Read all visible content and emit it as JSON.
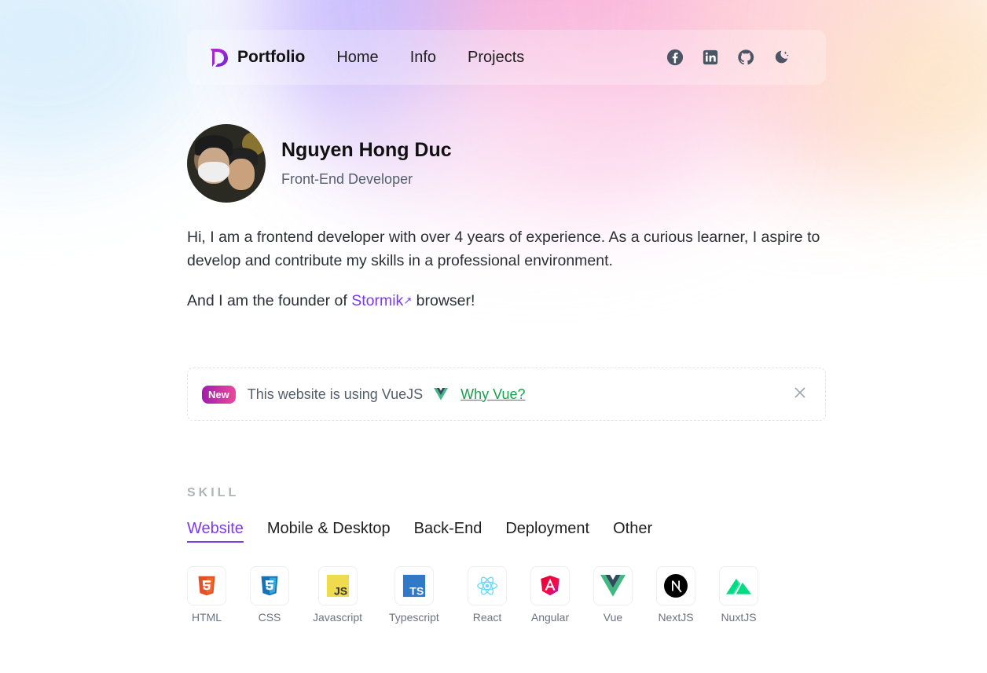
{
  "nav": {
    "brand": "Portfolio",
    "links": [
      "Home",
      "Info",
      "Projects"
    ],
    "icons": [
      "facebook-icon",
      "linkedin-icon",
      "github-icon",
      "theme-toggle-icon"
    ]
  },
  "profile": {
    "name": "Nguyen Hong Duc",
    "role": "Front-End Developer"
  },
  "bio": {
    "paragraph1": "Hi, I am a frontend developer with over 4 years of experience. As a curious learner, I aspire to develop and contribute my skills in a professional environment.",
    "paragraph2_prefix": "And I am the founder of ",
    "link_text": "Stormik",
    "paragraph2_suffix": " browser!"
  },
  "notice": {
    "badge": "New",
    "text": "This website is using VueJS",
    "link": "Why Vue?"
  },
  "skills": {
    "title": "SKILL",
    "tabs": [
      "Website",
      "Mobile & Desktop",
      "Back-End",
      "Deployment",
      "Other"
    ],
    "active_tab": "Website",
    "items": [
      "HTML",
      "CSS",
      "Javascript",
      "Typescript",
      "React",
      "Angular",
      "Vue",
      "NextJS",
      "NuxtJS"
    ]
  },
  "colors": {
    "accent": "#7c3aed",
    "link_green": "#16a34a"
  }
}
